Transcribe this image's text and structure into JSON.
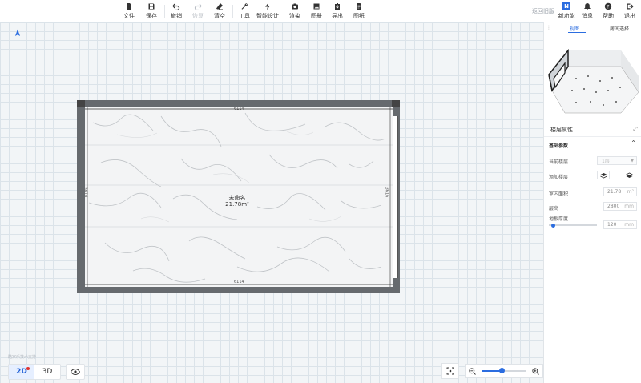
{
  "toolbar": {
    "items": [
      {
        "label": "文件",
        "icon": "file-icon"
      },
      {
        "label": "保存",
        "icon": "save-icon"
      },
      {
        "label": "撤销",
        "icon": "undo-icon"
      },
      {
        "label": "恢复",
        "icon": "redo-icon"
      },
      {
        "label": "清空",
        "icon": "eraser-icon"
      },
      {
        "label": "工具",
        "icon": "wrench-icon"
      },
      {
        "label": "智能设计",
        "icon": "lightning-icon"
      },
      {
        "label": "渲染",
        "icon": "camera-icon"
      },
      {
        "label": "图册",
        "icon": "album-icon"
      },
      {
        "label": "导出",
        "icon": "export-icon"
      },
      {
        "label": "图纸",
        "icon": "drawing-icon"
      }
    ],
    "back_label": "返回旧版",
    "new_feature": {
      "badge": "N",
      "label": "新功能"
    },
    "message_label": "消息",
    "help_label": "帮助",
    "exit_label": "退出"
  },
  "canvas": {
    "room_name": "未命名",
    "room_area": "21.78m²",
    "dim_top": "6114",
    "dim_bottom": "6114",
    "dim_left": "3616",
    "dim_right": "3616",
    "footer_note": "酷家乐技术支持",
    "view_2d": "2D",
    "view_3d": "3D",
    "zoom_level": 0.45
  },
  "panel": {
    "tab_view": "视图",
    "tab_room": "房间选择",
    "props_title": "楼层属性",
    "section": "基础参数",
    "current_floor_label": "当前楼层",
    "current_floor_value": "1层",
    "add_floor_label": "添加楼层",
    "indoor_area_label": "室内面积",
    "indoor_area_value": "21.78",
    "indoor_area_unit": "m²",
    "floor_height_label": "层高",
    "floor_height_value": "2800",
    "floor_height_unit": "mm",
    "slab_label": "地板厚度",
    "slab_value": "120",
    "slab_unit": "mm",
    "slab_level": 0.05
  },
  "colors": {
    "accent": "#2b6de0",
    "wall": "#666a6e",
    "red_dot": "#e0332f"
  }
}
